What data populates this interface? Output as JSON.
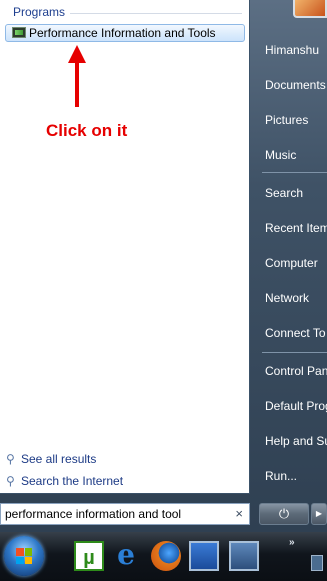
{
  "left_pane": {
    "section_title": "Programs",
    "result_label": "Performance Information and Tools",
    "links": [
      {
        "label": "See all results"
      },
      {
        "label": "Search the Internet"
      }
    ]
  },
  "annotation": {
    "text": "Click on it",
    "color": "#e60000"
  },
  "search": {
    "value": "performance information and tool",
    "clear_symbol": "×"
  },
  "right_pane": {
    "items": [
      {
        "label": "Himanshu"
      },
      {
        "label": "Documents"
      },
      {
        "label": "Pictures"
      },
      {
        "label": "Music"
      },
      {
        "label": "Search"
      },
      {
        "label": "Recent Items"
      },
      {
        "label": "Computer"
      },
      {
        "label": "Network"
      },
      {
        "label": "Connect To"
      },
      {
        "label": "Control Panel"
      },
      {
        "label": "Default Programs"
      },
      {
        "label": "Help and Support"
      },
      {
        "label": "Run..."
      }
    ]
  },
  "power": {
    "symbol": "⏻",
    "lock_symbol": "▶"
  },
  "taskbar": {
    "utorrent_glyph": "µ",
    "ie_glyph": "e",
    "chevron": "»"
  },
  "icons": [
    "programs-result-icon",
    "search-glass-icon",
    "power-icon",
    "lock-arrow-icon",
    "windows-start-icon",
    "utorrent-icon",
    "internet-explorer-icon",
    "firefox-icon",
    "show-desktop-icon",
    "switch-windows-icon"
  ]
}
